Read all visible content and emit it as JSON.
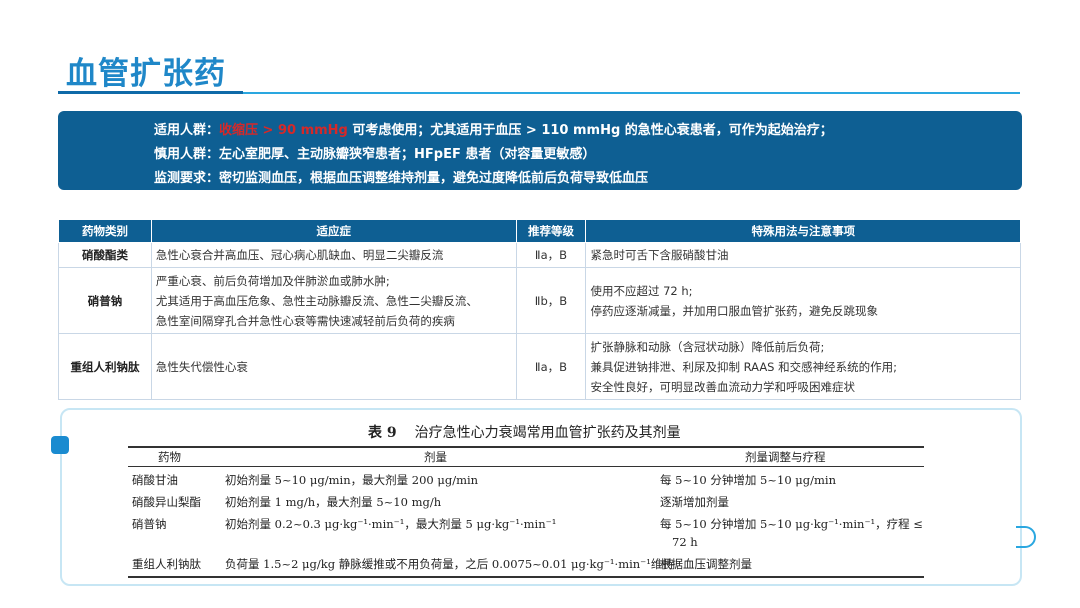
{
  "title": "血管扩张药",
  "info": {
    "line1_prefix": "适用人群：",
    "line1_highlight": "收缩压 > 90 mmHg",
    "line1_rest": "可考虑使用；尤其适用于血压 > 110 mmHg 的急性心衰患者，可作为起始治疗；",
    "line2": "慎用人群：左心室肥厚、主动脉瓣狭窄患者；HFpEF 患者（对容量更敏感）",
    "line3": "监测要求：密切监测血压，根据血压调整维持剂量，避免过度降低前后负荷导致低血压",
    "highlight_color": "#d62828"
  },
  "table": {
    "headers": [
      "药物类别",
      "适应症",
      "推荐等级",
      "特殊用法与注意事项"
    ],
    "rows": [
      {
        "category": "硝酸酯类",
        "indication": [
          "急性心衰合并高血压、冠心病心肌缺血、明显二尖瓣反流"
        ],
        "grade": "Ⅱa，B",
        "notes": [
          "紧急时可舌下含服硝酸甘油"
        ]
      },
      {
        "category": "硝普钠",
        "indication": [
          "严重心衰、前后负荷增加及伴肺淤血或肺水肿;",
          "尤其适用于高血压危象、急性主动脉瓣反流、急性二尖瓣反流、",
          "急性室间隔穿孔合并急性心衰等需快速减轻前后负荷的疾病"
        ],
        "grade": "Ⅱb，B",
        "notes": [
          "使用不应超过 72 h;",
          "停药应逐渐减量，并加用口服血管扩张药，避免反跳现象"
        ]
      },
      {
        "category": "重组人利钠肽",
        "indication": [
          "急性失代偿性心衰"
        ],
        "grade": "Ⅱa，B",
        "notes": [
          "扩张静脉和动脉（含冠状动脉）降低前后负荷;",
          "兼具促进钠排泄、利尿及抑制 RAAS 和交感神经系统的作用;",
          "安全性良好，可明显改善血流动力学和呼吸困难症状"
        ]
      }
    ]
  },
  "table9": {
    "number": "表 9",
    "caption": "治疗急性心力衰竭常用血管扩张药及其剂量",
    "headers": [
      "药物",
      "剂量",
      "剂量调整与疗程"
    ],
    "rows": [
      {
        "drug": "硝酸甘油",
        "dose": "初始剂量 5~10 μg/min，最大剂量 200 μg/min",
        "adjust": [
          "每 5~10 分钟增加 5~10 μg/min"
        ]
      },
      {
        "drug": "硝酸异山梨酯",
        "dose": "初始剂量 1 mg/h，最大剂量 5~10 mg/h",
        "adjust": [
          "逐渐增加剂量"
        ]
      },
      {
        "drug": "硝普钠",
        "dose": "初始剂量 0.2~0.3 μg·kg⁻¹·min⁻¹，最大剂量 5 μg·kg⁻¹·min⁻¹",
        "adjust": [
          "每 5~10 分钟增加 5~10 μg·kg⁻¹·min⁻¹，疗程 ≤",
          "72 h"
        ]
      },
      {
        "drug": "重组人利钠肽",
        "dose": "负荷量 1.5~2 μg/kg 静脉缓推或不用负荷量，之后 0.0075~0.01 μg·kg⁻¹·min⁻¹维持",
        "adjust": [
          "根据血压调整剂量"
        ]
      }
    ]
  },
  "colors": {
    "title": "#1f87c8",
    "band": "#0e5f93",
    "accent": "#2aa7e0"
  },
  "icons": [
    "square-marker-icon",
    "arc-decoration-icon"
  ]
}
